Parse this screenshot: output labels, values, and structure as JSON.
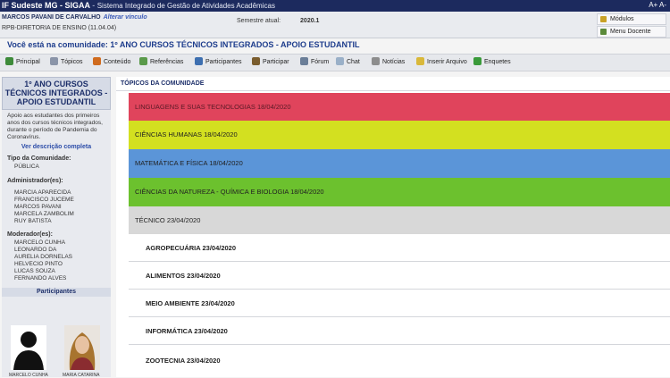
{
  "topbar": {
    "system": "IF Sudeste MG - SIGAA",
    "separator": "-",
    "system_fullname": "Sistema Integrado de Gestão de Atividades Acadêmicas",
    "font_controls": "A+ A-"
  },
  "user": {
    "name": "MARCOS PAVANI DE CARVALHO",
    "change_link": "Alterar vínculo",
    "unit": "RPB-DIRETORIA DE ENSINO (11.04.04)",
    "semester_label": "Semestre atual:",
    "semester_value": "2020.1"
  },
  "quick_links": [
    {
      "label": "Módulos",
      "icon": "modules-icon",
      "color": "#c9a227"
    },
    {
      "label": "Menu Docente",
      "icon": "network-icon",
      "color": "#5b8a3a"
    }
  ],
  "community_banner": "Você está na comunidade: 1º ANO CURSOS TÉCNICOS INTEGRADOS - APOIO ESTUDANTIL",
  "nav": [
    {
      "label": "Principal",
      "icon": "home-icon",
      "color": "#3e8b3a"
    },
    {
      "label": "Tópicos",
      "icon": "topics-icon",
      "color": "#8a94a8"
    },
    {
      "label": "Conteúdo",
      "icon": "content-icon",
      "color": "#d06b1e"
    },
    {
      "label": "Referências",
      "icon": "references-icon",
      "color": "#5a9a4a"
    },
    {
      "label": "Participantes",
      "icon": "participants-icon",
      "color": "#3d6fb0"
    },
    {
      "label": "Participar",
      "icon": "join-icon",
      "color": "#7a5d2e"
    },
    {
      "label": "Fórum",
      "icon": "forum-icon",
      "color": "#6a7e98"
    },
    {
      "label": "Chat",
      "icon": "chat-icon",
      "color": "#9ab0c8"
    },
    {
      "label": "Notícias",
      "icon": "news-icon",
      "color": "#8d8d8d"
    },
    {
      "label": "Inserir Arquivo",
      "icon": "file-icon",
      "color": "#d9b83a"
    },
    {
      "label": "Enquetes",
      "icon": "poll-icon",
      "color": "#3a9a3a"
    }
  ],
  "sidebar": {
    "title": "1º ANO CURSOS TÉCNICOS INTEGRADOS - APOIO ESTUDANTIL",
    "description": "Apoio aos estudantes dos primeiros anos dos cursos técnicos integrados, durante o período de Pandemia do Coronavírus.",
    "more_link": "Ver descrição completa",
    "type_label": "Tipo da Comunidade:",
    "type_value": "PÚBLICA",
    "admins_label": "Administrador(es):",
    "admins": [
      "MARCIA APARECIDA",
      "FRANCISCO JUCEME",
      "MARCOS PAVANI",
      "MARCELA ZAMBOLIM",
      "RUY BATISTA"
    ],
    "mods_label": "Moderador(es):",
    "mods": [
      "MARCELO CUNHA",
      "LEONARDO DA",
      "AURELIA DORNELAS",
      "HELVECIO PINTO",
      "LUCAS SOUZA",
      "FERNANDO ALVES"
    ],
    "participants_label": "Participantes",
    "participants": [
      "MARCELO CUNHA",
      "MARIA CATARINA"
    ]
  },
  "main": {
    "header": "TÓPICOS DA COMUNIDADE",
    "topics": [
      {
        "label": "LINGUAGENS E SUAS TECNOLOGIAS 18/04/2020",
        "color": "#e0445c"
      },
      {
        "label": "CIÊNCIAS HUMANAS 18/04/2020",
        "color": "#d3e020"
      },
      {
        "label": "MATEMÁTICA E FÍSICA 18/04/2020",
        "color": "#5b95d8"
      },
      {
        "label": "CIÊNCIAS DA NATUREZA - QUÍMICA E BIOLOGIA 18/04/2020",
        "color": "#6cc12e"
      },
      {
        "label": "TÉCNICO 23/04/2020",
        "color": "#d8d8d8"
      }
    ],
    "subtopics": [
      "AGROPECUÁRIA 23/04/2020",
      "ALIMENTOS 23/04/2020",
      "MEIO AMBIENTE 23/04/2020",
      "INFORMÁTICA 23/04/2020",
      "ZOOTECNIA 23/04/2020"
    ]
  }
}
